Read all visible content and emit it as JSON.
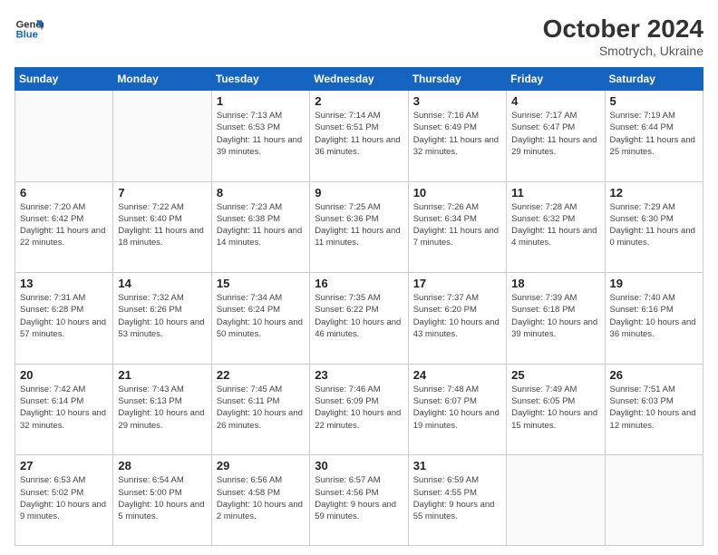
{
  "header": {
    "logo_line1": "General",
    "logo_line2": "Blue",
    "main_title": "October 2024",
    "subtitle": "Smotrych, Ukraine"
  },
  "weekdays": [
    "Sunday",
    "Monday",
    "Tuesday",
    "Wednesday",
    "Thursday",
    "Friday",
    "Saturday"
  ],
  "weeks": [
    [
      {
        "day": "",
        "sunrise": "",
        "sunset": "",
        "daylight": "",
        "empty": true
      },
      {
        "day": "",
        "sunrise": "",
        "sunset": "",
        "daylight": "",
        "empty": true
      },
      {
        "day": "1",
        "sunrise": "Sunrise: 7:13 AM",
        "sunset": "Sunset: 6:53 PM",
        "daylight": "Daylight: 11 hours and 39 minutes.",
        "empty": false
      },
      {
        "day": "2",
        "sunrise": "Sunrise: 7:14 AM",
        "sunset": "Sunset: 6:51 PM",
        "daylight": "Daylight: 11 hours and 36 minutes.",
        "empty": false
      },
      {
        "day": "3",
        "sunrise": "Sunrise: 7:16 AM",
        "sunset": "Sunset: 6:49 PM",
        "daylight": "Daylight: 11 hours and 32 minutes.",
        "empty": false
      },
      {
        "day": "4",
        "sunrise": "Sunrise: 7:17 AM",
        "sunset": "Sunset: 6:47 PM",
        "daylight": "Daylight: 11 hours and 29 minutes.",
        "empty": false
      },
      {
        "day": "5",
        "sunrise": "Sunrise: 7:19 AM",
        "sunset": "Sunset: 6:44 PM",
        "daylight": "Daylight: 11 hours and 25 minutes.",
        "empty": false
      }
    ],
    [
      {
        "day": "6",
        "sunrise": "Sunrise: 7:20 AM",
        "sunset": "Sunset: 6:42 PM",
        "daylight": "Daylight: 11 hours and 22 minutes.",
        "empty": false
      },
      {
        "day": "7",
        "sunrise": "Sunrise: 7:22 AM",
        "sunset": "Sunset: 6:40 PM",
        "daylight": "Daylight: 11 hours and 18 minutes.",
        "empty": false
      },
      {
        "day": "8",
        "sunrise": "Sunrise: 7:23 AM",
        "sunset": "Sunset: 6:38 PM",
        "daylight": "Daylight: 11 hours and 14 minutes.",
        "empty": false
      },
      {
        "day": "9",
        "sunrise": "Sunrise: 7:25 AM",
        "sunset": "Sunset: 6:36 PM",
        "daylight": "Daylight: 11 hours and 11 minutes.",
        "empty": false
      },
      {
        "day": "10",
        "sunrise": "Sunrise: 7:26 AM",
        "sunset": "Sunset: 6:34 PM",
        "daylight": "Daylight: 11 hours and 7 minutes.",
        "empty": false
      },
      {
        "day": "11",
        "sunrise": "Sunrise: 7:28 AM",
        "sunset": "Sunset: 6:32 PM",
        "daylight": "Daylight: 11 hours and 4 minutes.",
        "empty": false
      },
      {
        "day": "12",
        "sunrise": "Sunrise: 7:29 AM",
        "sunset": "Sunset: 6:30 PM",
        "daylight": "Daylight: 11 hours and 0 minutes.",
        "empty": false
      }
    ],
    [
      {
        "day": "13",
        "sunrise": "Sunrise: 7:31 AM",
        "sunset": "Sunset: 6:28 PM",
        "daylight": "Daylight: 10 hours and 57 minutes.",
        "empty": false
      },
      {
        "day": "14",
        "sunrise": "Sunrise: 7:32 AM",
        "sunset": "Sunset: 6:26 PM",
        "daylight": "Daylight: 10 hours and 53 minutes.",
        "empty": false
      },
      {
        "day": "15",
        "sunrise": "Sunrise: 7:34 AM",
        "sunset": "Sunset: 6:24 PM",
        "daylight": "Daylight: 10 hours and 50 minutes.",
        "empty": false
      },
      {
        "day": "16",
        "sunrise": "Sunrise: 7:35 AM",
        "sunset": "Sunset: 6:22 PM",
        "daylight": "Daylight: 10 hours and 46 minutes.",
        "empty": false
      },
      {
        "day": "17",
        "sunrise": "Sunrise: 7:37 AM",
        "sunset": "Sunset: 6:20 PM",
        "daylight": "Daylight: 10 hours and 43 minutes.",
        "empty": false
      },
      {
        "day": "18",
        "sunrise": "Sunrise: 7:39 AM",
        "sunset": "Sunset: 6:18 PM",
        "daylight": "Daylight: 10 hours and 39 minutes.",
        "empty": false
      },
      {
        "day": "19",
        "sunrise": "Sunrise: 7:40 AM",
        "sunset": "Sunset: 6:16 PM",
        "daylight": "Daylight: 10 hours and 36 minutes.",
        "empty": false
      }
    ],
    [
      {
        "day": "20",
        "sunrise": "Sunrise: 7:42 AM",
        "sunset": "Sunset: 6:14 PM",
        "daylight": "Daylight: 10 hours and 32 minutes.",
        "empty": false
      },
      {
        "day": "21",
        "sunrise": "Sunrise: 7:43 AM",
        "sunset": "Sunset: 6:13 PM",
        "daylight": "Daylight: 10 hours and 29 minutes.",
        "empty": false
      },
      {
        "day": "22",
        "sunrise": "Sunrise: 7:45 AM",
        "sunset": "Sunset: 6:11 PM",
        "daylight": "Daylight: 10 hours and 26 minutes.",
        "empty": false
      },
      {
        "day": "23",
        "sunrise": "Sunrise: 7:46 AM",
        "sunset": "Sunset: 6:09 PM",
        "daylight": "Daylight: 10 hours and 22 minutes.",
        "empty": false
      },
      {
        "day": "24",
        "sunrise": "Sunrise: 7:48 AM",
        "sunset": "Sunset: 6:07 PM",
        "daylight": "Daylight: 10 hours and 19 minutes.",
        "empty": false
      },
      {
        "day": "25",
        "sunrise": "Sunrise: 7:49 AM",
        "sunset": "Sunset: 6:05 PM",
        "daylight": "Daylight: 10 hours and 15 minutes.",
        "empty": false
      },
      {
        "day": "26",
        "sunrise": "Sunrise: 7:51 AM",
        "sunset": "Sunset: 6:03 PM",
        "daylight": "Daylight: 10 hours and 12 minutes.",
        "empty": false
      }
    ],
    [
      {
        "day": "27",
        "sunrise": "Sunrise: 6:53 AM",
        "sunset": "Sunset: 5:02 PM",
        "daylight": "Daylight: 10 hours and 9 minutes.",
        "empty": false
      },
      {
        "day": "28",
        "sunrise": "Sunrise: 6:54 AM",
        "sunset": "Sunset: 5:00 PM",
        "daylight": "Daylight: 10 hours and 5 minutes.",
        "empty": false
      },
      {
        "day": "29",
        "sunrise": "Sunrise: 6:56 AM",
        "sunset": "Sunset: 4:58 PM",
        "daylight": "Daylight: 10 hours and 2 minutes.",
        "empty": false
      },
      {
        "day": "30",
        "sunrise": "Sunrise: 6:57 AM",
        "sunset": "Sunset: 4:56 PM",
        "daylight": "Daylight: 9 hours and 59 minutes.",
        "empty": false
      },
      {
        "day": "31",
        "sunrise": "Sunrise: 6:59 AM",
        "sunset": "Sunset: 4:55 PM",
        "daylight": "Daylight: 9 hours and 55 minutes.",
        "empty": false
      },
      {
        "day": "",
        "sunrise": "",
        "sunset": "",
        "daylight": "",
        "empty": true
      },
      {
        "day": "",
        "sunrise": "",
        "sunset": "",
        "daylight": "",
        "empty": true
      }
    ]
  ]
}
